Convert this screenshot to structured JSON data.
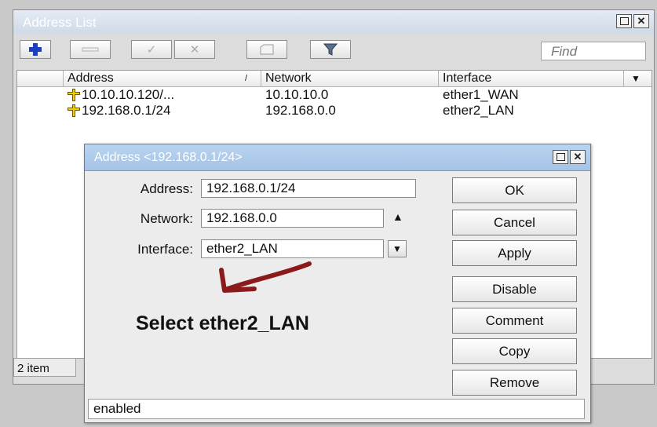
{
  "outer": {
    "title": "Address List",
    "find_placeholder": "Find",
    "columns": [
      "Address",
      "Network",
      "Interface"
    ],
    "sort_indicator": "/",
    "rows": [
      {
        "address": "10.10.10.120/...",
        "network": "10.10.10.0",
        "interface": "ether1_WAN"
      },
      {
        "address": "192.168.0.1/24",
        "network": "192.168.0.0",
        "interface": "ether2_LAN"
      }
    ],
    "status": "2 item"
  },
  "dialog": {
    "title": "Address <192.168.0.1/24>",
    "fields": {
      "address_label": "Address:",
      "address_value": "192.168.0.1/24",
      "network_label": "Network:",
      "network_value": "192.168.0.0",
      "interface_label": "Interface:",
      "interface_value": "ether2_LAN"
    },
    "buttons": {
      "ok": "OK",
      "cancel": "Cancel",
      "apply": "Apply",
      "disable": "Disable",
      "comment": "Comment",
      "copy": "Copy",
      "remove": "Remove"
    },
    "status": "enabled",
    "annotation": "Select ether2_LAN"
  },
  "colors": {
    "outer_title_gradient": "#dbe5f0",
    "dialog_title_gradient": "#aecbeb",
    "add_icon": "#1a3fbf",
    "annotation_arrow": "#8b1a1a"
  },
  "icons": [
    "add-icon",
    "remove-icon",
    "enable-check-icon",
    "disable-x-icon",
    "comment-note-icon",
    "filter-funnel-icon",
    "address-plus-icon",
    "sort-arrow-icon",
    "dropdown-icon"
  ]
}
